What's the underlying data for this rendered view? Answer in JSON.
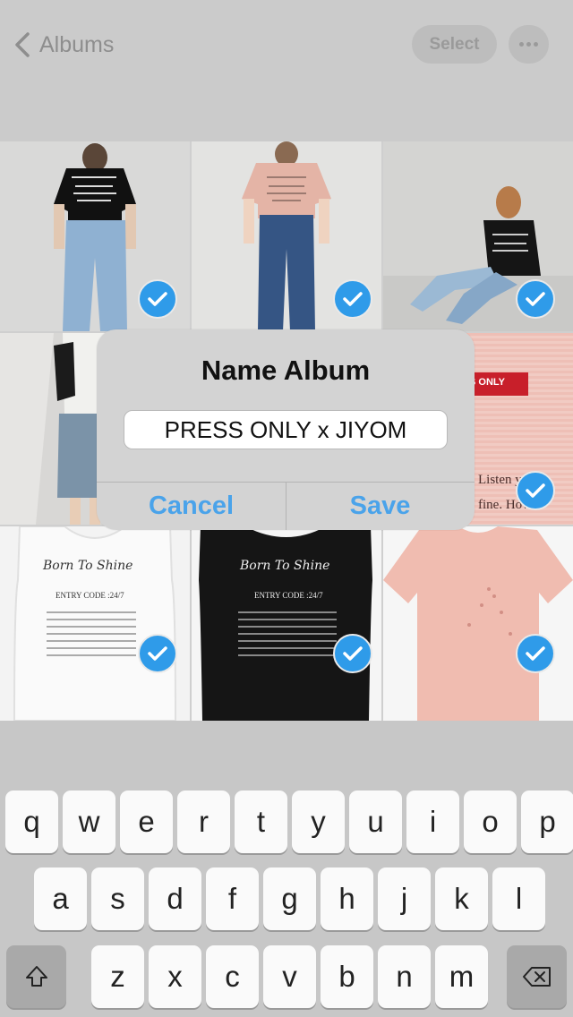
{
  "header": {
    "back_label": "Albums",
    "select_label": "Select"
  },
  "dialog": {
    "title": "Name Album",
    "input_value": "PRESS ONLY x JIYOM",
    "cancel_label": "Cancel",
    "save_label": "Save"
  },
  "photos": {
    "tile_6_text": "Listen yo\nfine. How\nere are you?",
    "tile_6_tag": "S ONLY",
    "tile_7_script": "Born To Shine",
    "tile_7_entry": "ENTRY CODE :24/7",
    "tile_8_script": "Born To Shine",
    "tile_8_entry": "ENTRY CODE :24/7"
  },
  "keyboard": {
    "row1": [
      "q",
      "w",
      "e",
      "r",
      "t",
      "y",
      "u",
      "i",
      "o",
      "p"
    ],
    "row2": [
      "a",
      "s",
      "d",
      "f",
      "g",
      "h",
      "j",
      "k",
      "l"
    ],
    "row3": [
      "z",
      "x",
      "c",
      "v",
      "b",
      "n",
      "m"
    ]
  },
  "colors": {
    "accent": "#2f9be9",
    "dialog_button": "#4aa3ea"
  }
}
